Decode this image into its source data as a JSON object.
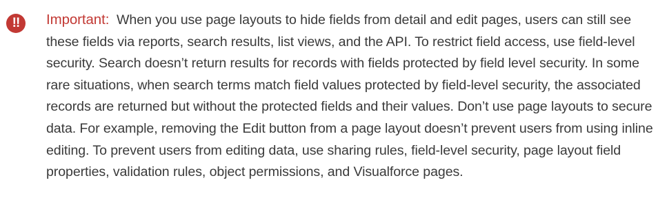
{
  "note": {
    "icon": "exclamation-icon",
    "accent_color": "#c23934",
    "label": "Important:",
    "text": "When you use page layouts to hide fields from detail and edit pages, users can still see these fields via reports, search results, list views, and the API. To restrict field access, use field-level security. Search doesn’t return results for records with fields protected by field level security. In some rare situations, when search terms match field values protected by field-level security, the associated records are returned but without the protected fields and their values. Don’t use page layouts to secure data. For example, removing the Edit button from a page layout doesn’t prevent users from using inline editing. To prevent users from editing data, use sharing rules, field-level security, page layout field properties, validation rules, object permissions, and Visualforce pages."
  }
}
